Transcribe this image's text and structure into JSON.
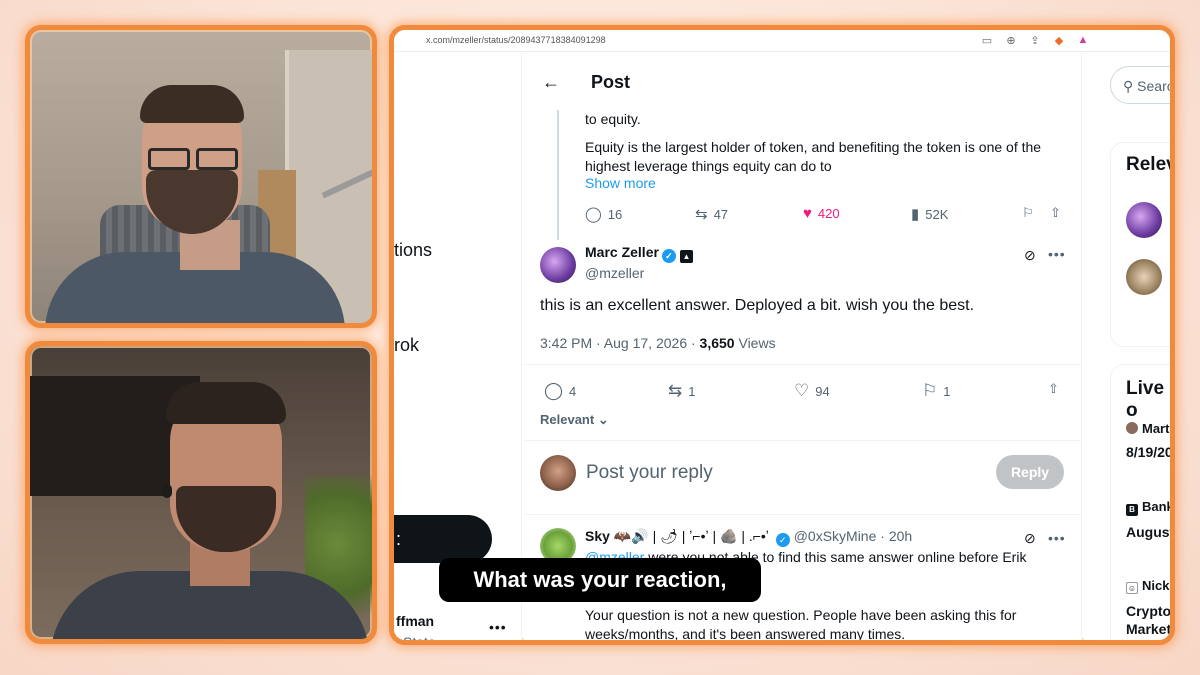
{
  "browser": {
    "url": "x.com/mzeller/status/2089437718384091298",
    "icons": [
      "screen-icon",
      "zoom-icon",
      "share-icon",
      "brave-icon",
      "alert-icon"
    ]
  },
  "leftnav": {
    "frag_notifications": "tions",
    "frag_grok": "rok",
    "post_button": ":",
    "account_name": "ffman",
    "account_handle": "sState",
    "account_more": "•••"
  },
  "post": {
    "back_label": "←",
    "title": "Post",
    "previous": {
      "text_line0": "to equity.",
      "text_line1": "Equity is the largest holder of token, and benefiting the token is one of the",
      "text_line2": "highest leverage things equity can do to",
      "show_more": "Show more",
      "replies": "16",
      "reposts": "47",
      "likes": "420",
      "views": "52K"
    },
    "main": {
      "author_name": "Marc Zeller",
      "author_handle": "@mzeller",
      "body": "this is an excellent answer. Deployed a bit. wish you the best.",
      "time": "3:42 PM · Aug 17, 2026 · ",
      "views_count": "3,650",
      "views_label": " Views",
      "replies": "4",
      "reposts": "1",
      "likes": "94",
      "bookmarks": "1"
    },
    "relevant_label": "Relevant",
    "reply_placeholder": "Post your reply",
    "reply_button": "Reply",
    "reply_thread": {
      "name": "Sky",
      "name_decor": "🦇🔊 | 🌶 | ʼ⌐•ʼ | 🪨 | .⌐•ʼ",
      "handle_time": "@0xSkyMine · 20h",
      "mention": "@mzeller",
      "reply_text": " were you not able to find this same answer online before Erik",
      "body_line1": "Your question is not a new question.  People have been asking this for",
      "body_line2": "weeks/months, and it's been answered many times."
    }
  },
  "rightcol": {
    "search_placeholder": "Searc",
    "relevant_people_title": "Relev",
    "live_title": "Live o",
    "live_items": [
      {
        "name": "Mart",
        "detail": "8/19/20"
      },
      {
        "name": "Bank",
        "detail": "August"
      },
      {
        "name": "Nick",
        "detail": "Crypto",
        "detail2": "Market"
      }
    ]
  },
  "caption": "What was your reaction,",
  "colors": {
    "frame_border": "#f08a3c",
    "accent_blue": "#1d9bf0",
    "like_pink": "#f91880"
  }
}
